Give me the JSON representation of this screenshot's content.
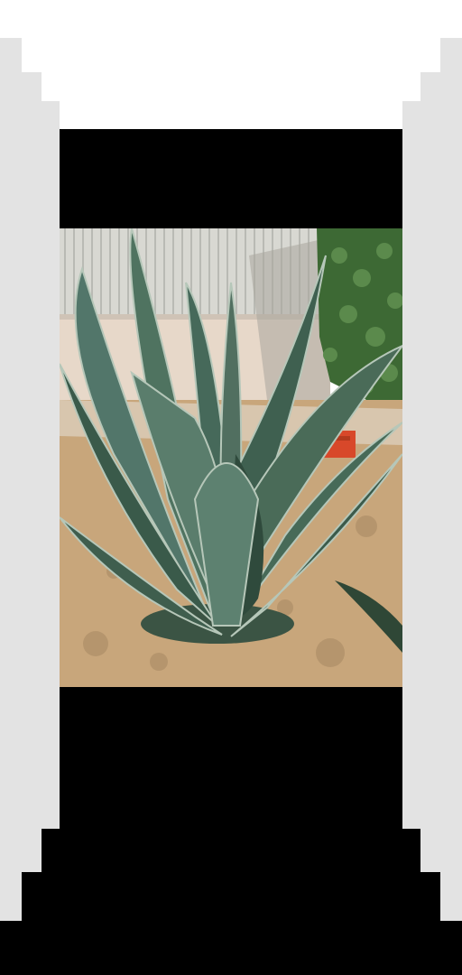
{
  "image": {
    "alt": "",
    "colors": {
      "background": "#ffffff",
      "frame_grey": "#e3e3e3",
      "letterbox": "#000000",
      "sky_wall": "#d9d9d3",
      "wall_stripes": "#b7b8b2",
      "wall_lower": "#e6d7c8",
      "hedge": "#3f6a36",
      "soil": "#c7a57a",
      "agave_leaf": "#4a6b58",
      "agave_leaf_dark": "#304a3c",
      "agave_edge": "#b6c7b9",
      "red_crate": "#d9492a"
    }
  }
}
